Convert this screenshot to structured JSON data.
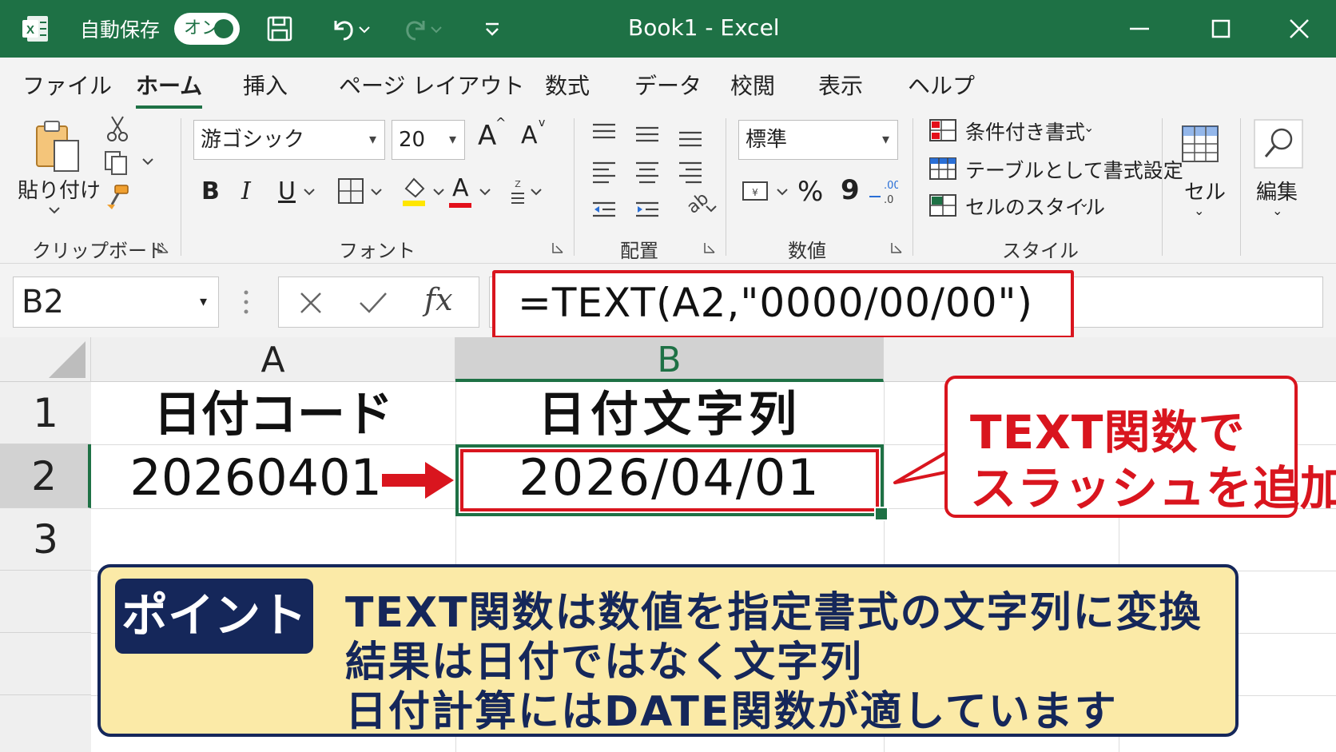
{
  "titlebar": {
    "autosave_label": "自動保存",
    "autosave_state": "オン",
    "title": "Book1  -  Excel",
    "app_color": "#1e7145"
  },
  "menu": {
    "tabs": [
      "ファイル",
      "ホーム",
      "挿入",
      "ページ レイアウト",
      "数式",
      "データ",
      "校閲",
      "表示",
      "ヘルプ"
    ],
    "active": "ホーム"
  },
  "ribbon": {
    "clipboard": {
      "paste": "貼り付け",
      "label": "クリップボード"
    },
    "font": {
      "font_name": "游ゴシック",
      "font_size": "20",
      "grow": "A",
      "shrink": "A",
      "bold": "B",
      "italic": "I",
      "underline": "U",
      "color_a": "A",
      "label": "フォント"
    },
    "align": {
      "label": "配置"
    },
    "number": {
      "format": "標準",
      "percent": "%",
      "comma": "9",
      "label": "数値"
    },
    "styles": {
      "conditional": "条件付き書式",
      "table": "テーブルとして書式設定",
      "cell_styles": "セルのスタイル",
      "label": "スタイル"
    },
    "cells": {
      "label": "セル"
    },
    "edit": {
      "label": "編集"
    }
  },
  "formula_bar": {
    "name_box": "B2",
    "fx": "fx",
    "formula": "=TEXT(A2,\"0000/00/00\")"
  },
  "sheet": {
    "columns": [
      "A",
      "B"
    ],
    "rows": [
      "1",
      "2",
      "3"
    ],
    "cells": {
      "A1": "日付コード",
      "B1": "日付文字列",
      "A2": "20260401",
      "B2": "2026/04/01"
    },
    "active_cell": "B2"
  },
  "callout": {
    "line1": "TEXT関数で",
    "line2": "スラッシュを追加",
    "color": "#d9151e"
  },
  "point": {
    "badge": "ポイント",
    "lines": [
      "TEXT関数は数値を指定書式の文字列に変換",
      "結果は日付ではなく文字列",
      "日付計算にはDATE関数が適しています"
    ],
    "bg_color": "#fbeaa7",
    "ink_color": "#15275a"
  }
}
